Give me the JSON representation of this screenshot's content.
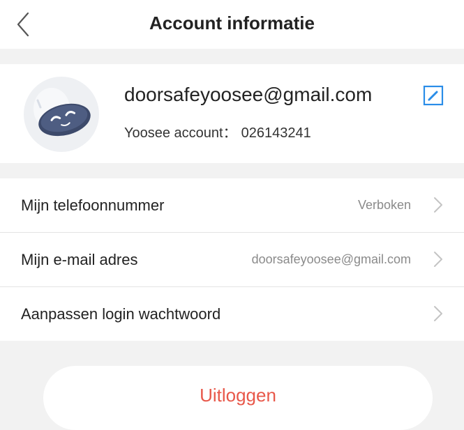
{
  "header": {
    "title": "Account informatie",
    "back_icon": "chevron-left-icon"
  },
  "profile": {
    "email": "doorsafeyoosee@gmail.com",
    "account_label": "Yoosee account：",
    "account_id": "026143241",
    "edit_icon": "edit-icon",
    "accent_color": "#2a8de8"
  },
  "settings": [
    {
      "label": "Mijn telefoonnummer",
      "value": "Verboken"
    },
    {
      "label": "Mijn e-mail adres",
      "value": "doorsafeyoosee@gmail.com"
    },
    {
      "label": "Aanpassen login wachtwoord",
      "value": ""
    }
  ],
  "logout": {
    "label": "Uitloggen",
    "color": "#e8584a"
  }
}
